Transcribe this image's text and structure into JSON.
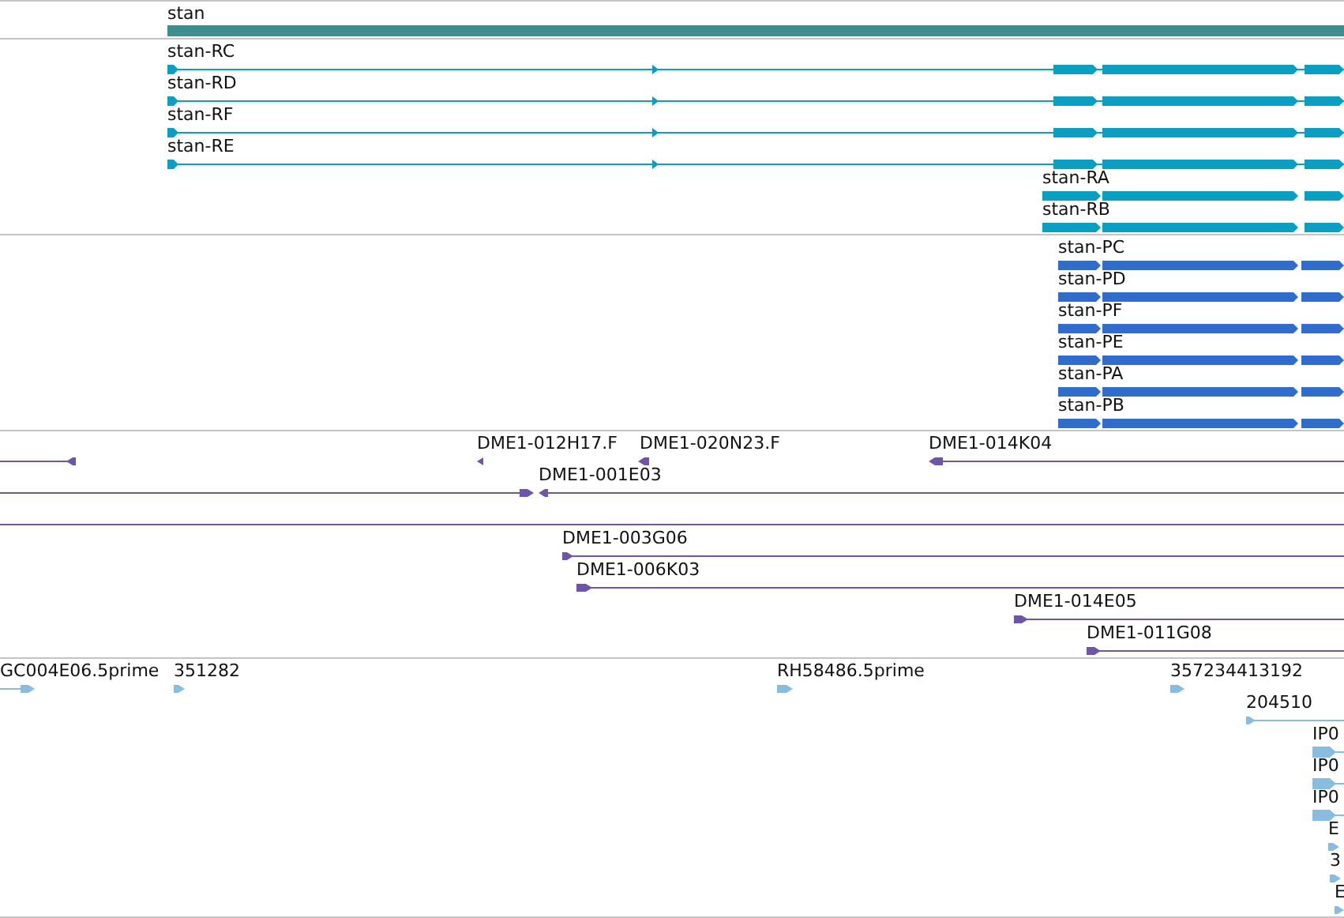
{
  "tracks": [
    {
      "kind": "gene",
      "rows": [
        {
          "features": [
            {
              "label": "stan"
            }
          ]
        }
      ]
    },
    {
      "kind": "transcript",
      "rows": [
        {
          "features": [
            {
              "label": "stan-RC",
              "reverse": false
            }
          ]
        },
        {
          "features": [
            {
              "label": "stan-RD",
              "reverse": false
            }
          ]
        },
        {
          "features": [
            {
              "label": "stan-RF",
              "reverse": false
            }
          ]
        },
        {
          "features": [
            {
              "label": "stan-RE",
              "reverse": false
            }
          ]
        },
        {
          "features": [
            {
              "label": "stan-RA",
              "reverse": false
            }
          ]
        },
        {
          "features": [
            {
              "label": "stan-RB",
              "reverse": false
            }
          ]
        }
      ]
    },
    {
      "kind": "protein",
      "rows": [
        {
          "features": [
            {
              "label": "stan-PC",
              "reverse": false
            }
          ]
        },
        {
          "features": [
            {
              "label": "stan-PD",
              "reverse": false
            }
          ]
        },
        {
          "features": [
            {
              "label": "stan-PF",
              "reverse": false
            }
          ]
        },
        {
          "features": [
            {
              "label": "stan-PE",
              "reverse": false
            }
          ]
        },
        {
          "features": [
            {
              "label": "stan-PA",
              "reverse": false
            }
          ]
        },
        {
          "features": [
            {
              "label": "stan-PB",
              "reverse": false
            }
          ]
        }
      ]
    },
    {
      "kind": "clone",
      "rows": [
        {
          "features": [
            {
              "reverse": true
            },
            {
              "label": "DME1-012H17.F",
              "reverse": true
            },
            {
              "label": "DME1-020N23.F",
              "reverse": true
            },
            {
              "label": "DME1-014K04",
              "reverse": true
            }
          ]
        },
        {
          "features": [
            {
              "reverse": false
            },
            {
              "label": "DME1-001E03",
              "reverse": true
            }
          ]
        },
        {
          "features": [
            {
              "kind": "line"
            }
          ]
        },
        {
          "features": [
            {
              "label": "DME1-003G06",
              "reverse": false
            }
          ]
        },
        {
          "features": [
            {
              "label": "DME1-006K03",
              "reverse": false
            }
          ]
        },
        {
          "features": [
            {
              "label": "DME1-014E05",
              "reverse": false
            }
          ]
        },
        {
          "features": [
            {
              "label": "DME1-011G08",
              "reverse": false
            }
          ]
        }
      ]
    },
    {
      "kind": "est",
      "rows": [
        {
          "features": [
            {
              "label": "GC004E06.5prime",
              "reverse": false
            },
            {
              "label": "351282",
              "reverse": false
            },
            {
              "label": "RH58486.5prime",
              "reverse": false
            },
            {
              "label": "357234413192",
              "reverse": false
            }
          ]
        },
        {
          "features": [
            {
              "label": "204510",
              "reverse": false
            }
          ]
        },
        {
          "features": [
            {
              "label": "IP0",
              "reverse": false
            }
          ]
        },
        {
          "features": [
            {
              "label": "IP0",
              "reverse": false
            }
          ]
        },
        {
          "features": [
            {
              "label": "IP0",
              "reverse": false
            }
          ]
        },
        {
          "features": [
            {
              "label": "E",
              "reverse": false
            }
          ]
        },
        {
          "features": [
            {
              "label": "3",
              "reverse": false
            }
          ]
        },
        {
          "features": [
            {
              "label": "E",
              "reverse": false
            }
          ]
        }
      ]
    }
  ]
}
